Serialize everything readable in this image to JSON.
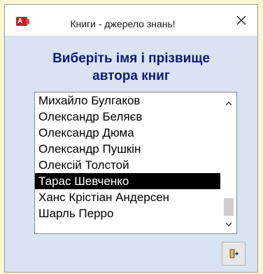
{
  "window": {
    "title": "Книги - джерело знань!",
    "app_icon_letter": "A",
    "close_glyph": "✕"
  },
  "heading": {
    "line1": "Виберіть імя і прізвище",
    "line2": "автора книг"
  },
  "author_list": {
    "items": [
      "Михайло Булгаков",
      "Олександр Беляєв",
      "Олександр Дюма",
      "Олександр Пушкін",
      "Олексій Толстой",
      "Тарас Шевченко",
      "Ханс Крістіан Андерсен",
      "Шарль Перро"
    ],
    "selected": "Тарас Шевченко"
  },
  "icons": {
    "app": "access-app-icon",
    "close": "close-icon",
    "scroll_up": "chevron-up-icon",
    "scroll_down": "chevron-down-icon",
    "exit": "exit-door-icon"
  },
  "colors": {
    "heading": "#0d1b73",
    "form_background": "#d9e3f1",
    "selection": "#000000",
    "app_icon": "#b7242a"
  }
}
